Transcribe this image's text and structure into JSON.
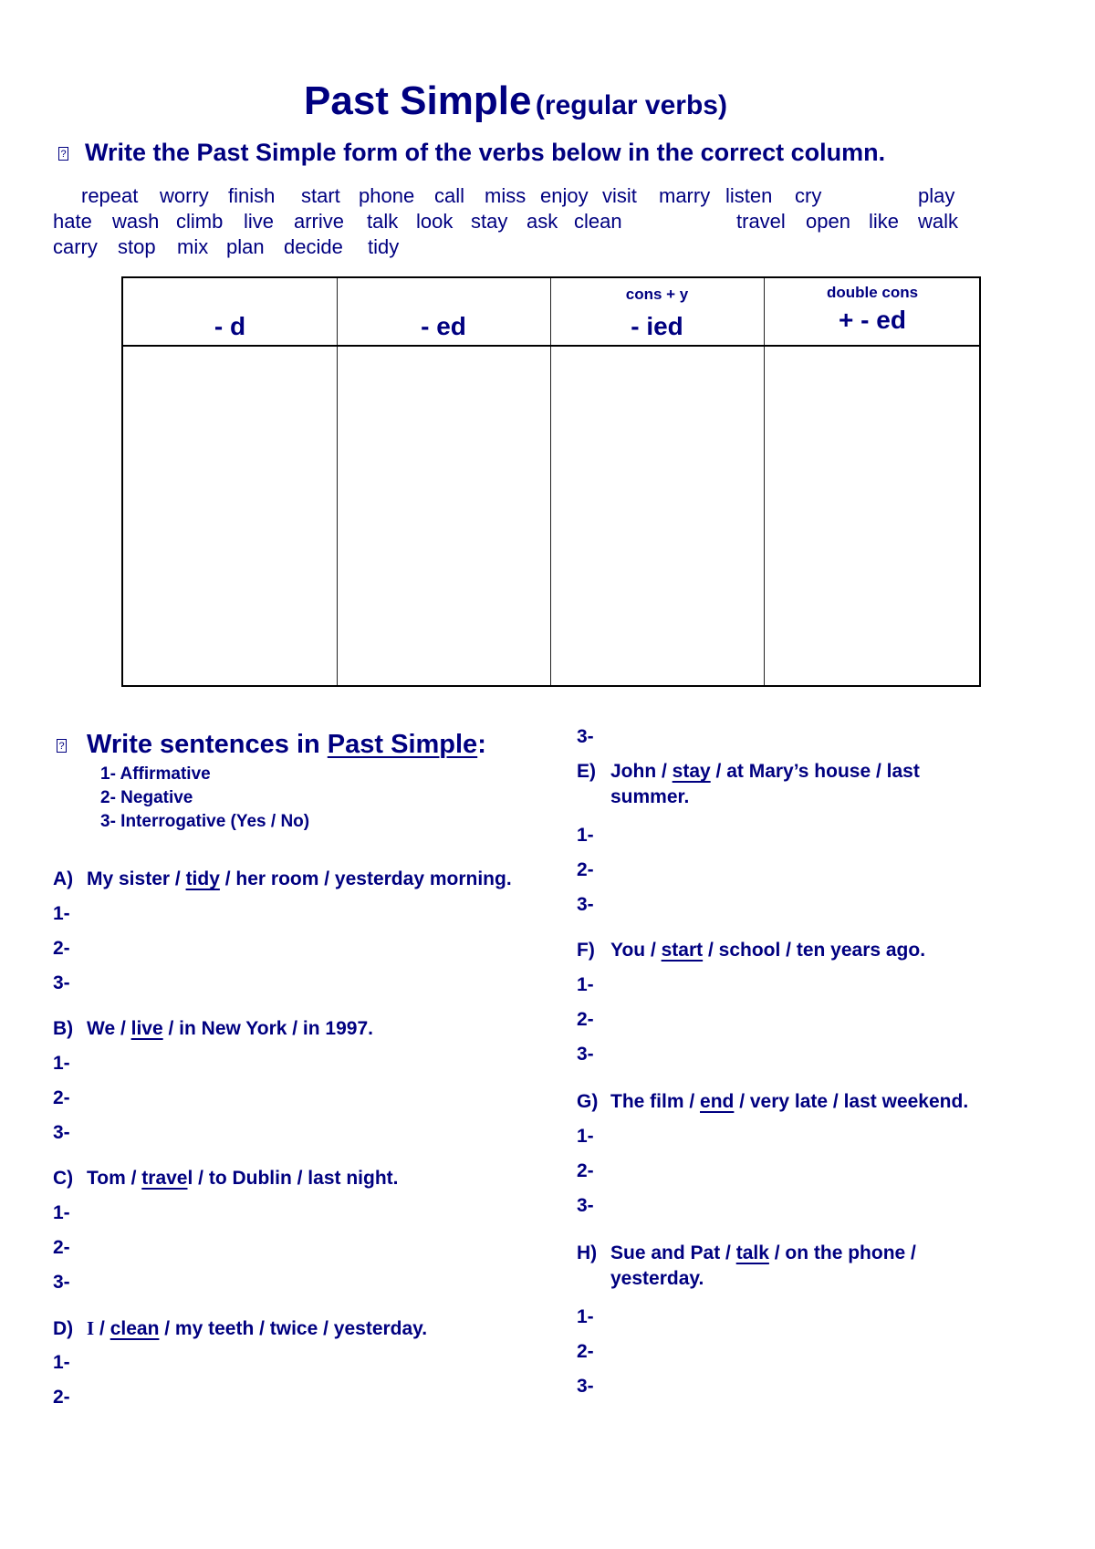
{
  "title": {
    "main": "Past Simple",
    "sub": "(regular verbs)"
  },
  "bullet_glyph": "?",
  "exercise1": {
    "instruction": "Write the Past Simple form of the verbs below in the correct column.",
    "verb_rows": [
      [
        "repeat",
        "worry",
        "finish",
        "start",
        "phone",
        "call",
        "miss",
        "enjoy",
        "visit",
        "marry",
        "listen",
        "cry",
        "play"
      ],
      [
        "hate",
        "wash",
        "climb",
        "live",
        "arrive",
        "talk",
        "look",
        "stay",
        "ask",
        "clean",
        "travel",
        "open",
        "like",
        "walk"
      ],
      [
        "carry",
        "stop",
        "mix",
        "plan",
        "decide",
        "tidy"
      ]
    ],
    "table": {
      "columns": [
        {
          "sub": "",
          "main": "- d"
        },
        {
          "sub": "",
          "main": "- ed"
        },
        {
          "sub": "cons  +  y",
          "main": "- ied"
        },
        {
          "sub": "double cons",
          "main": "+ - ed"
        }
      ]
    }
  },
  "exercise2": {
    "heading_prefix": "Write sentences in ",
    "heading_underlined": "Past Simple",
    "heading_suffix": ":",
    "types": [
      "1- Affirmative",
      "2- Negative",
      "3- Interrogative (Yes / No)"
    ],
    "answer_labels": [
      "1-",
      "2-",
      "3-"
    ],
    "items": [
      {
        "label": "A)",
        "before": "My sister / ",
        "verb": "tidy",
        "after": " / her room / yesterday morning."
      },
      {
        "label": "B)",
        "before": "We / ",
        "verb": "live",
        "after": " / in New York / in 1997."
      },
      {
        "label": "C)",
        "before": "Tom / ",
        "verb": "trave",
        "verb_tail": "l",
        "after": " / to Dublin / last night."
      },
      {
        "label": "D)",
        "before_serif": "I",
        "before": " / ",
        "verb": "clean",
        "after": " / my teeth / twice / yesterday."
      },
      {
        "label": "E)",
        "before": "John / ",
        "verb": "stay",
        "after": " / at Mary’s house / last",
        "line2": "summer."
      },
      {
        "label": "F)",
        "before": "You / ",
        "verb": "start",
        "after": " / school / ten years ago."
      },
      {
        "label": "G)",
        "before": "The film / ",
        "verb": "end",
        "after": " / very late / last weekend."
      },
      {
        "label": "H)",
        "before": "Sue and Pat  / ",
        "verb": "talk",
        "after": " / on the phone /",
        "line2": "yesterday."
      }
    ]
  }
}
